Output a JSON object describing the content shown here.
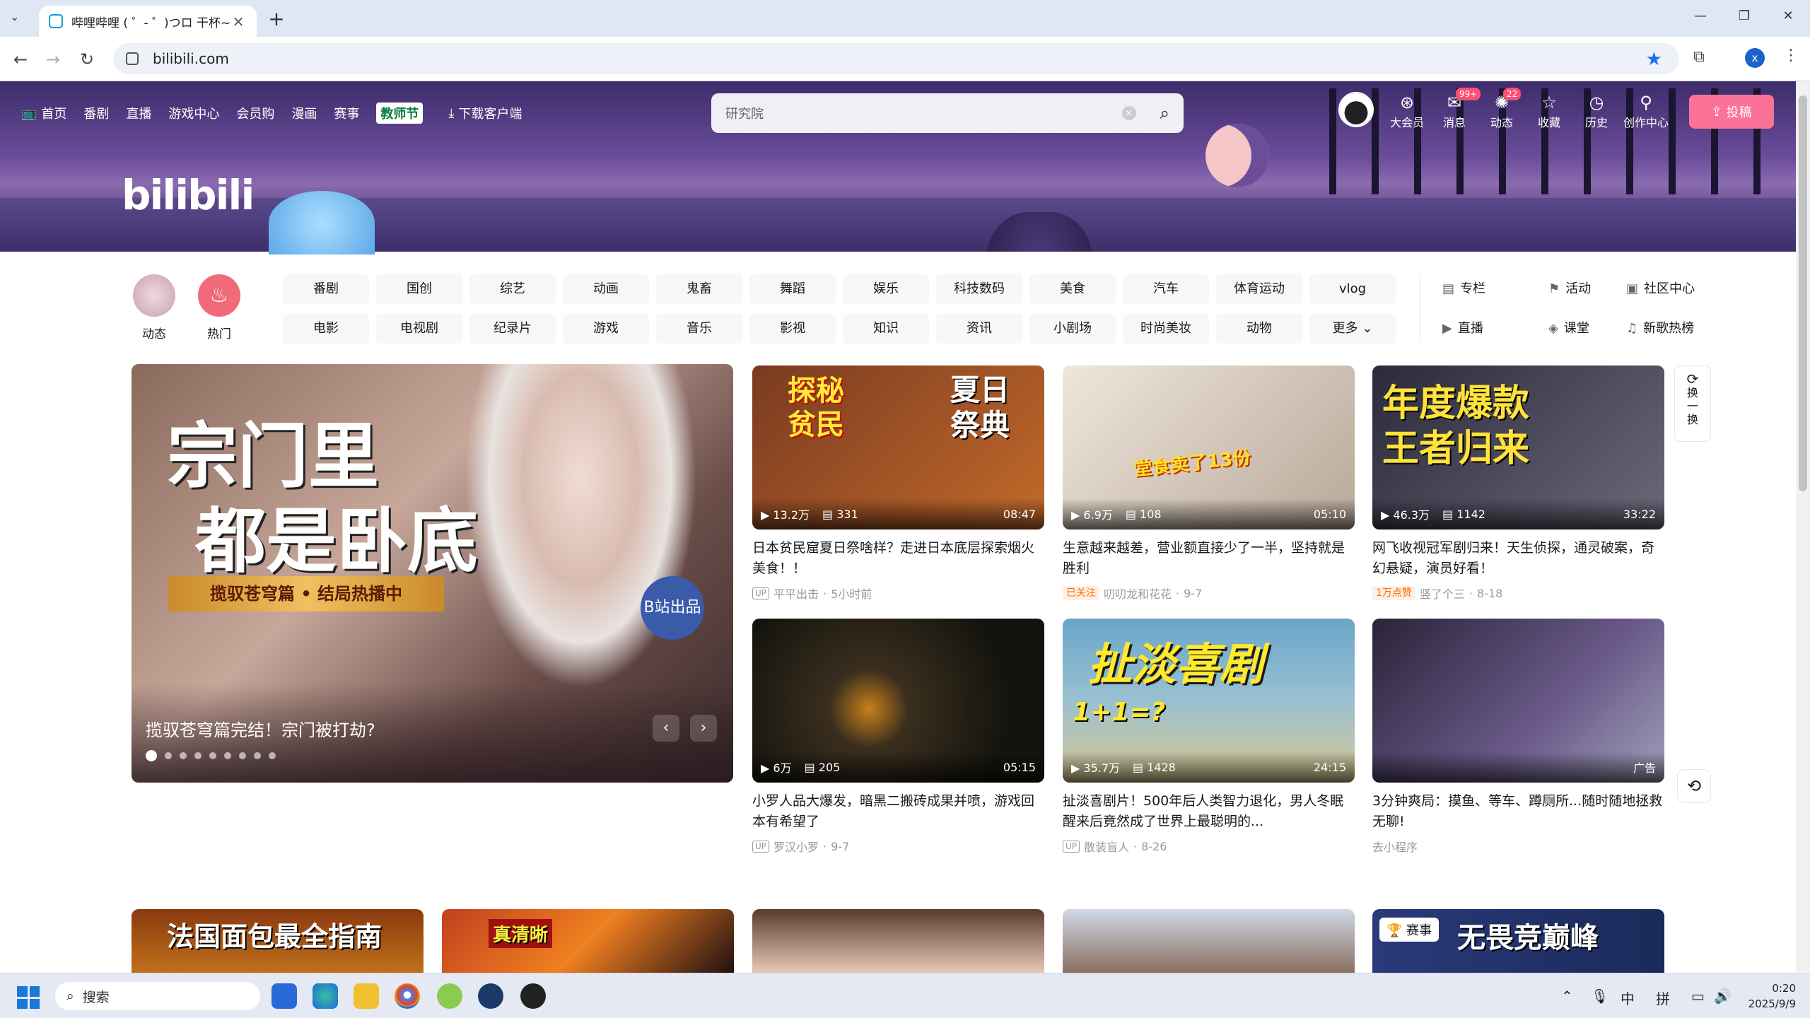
{
  "browser": {
    "tab_title": "哔哩哔哩 ( ゜- ゜)つロ 干杯~-b",
    "url": "bilibili.com"
  },
  "header": {
    "nav": [
      "首页",
      "番剧",
      "直播",
      "游戏中心",
      "会员购",
      "漫画",
      "赛事",
      "教师节",
      "下载客户端"
    ],
    "search_placeholder": "研究院",
    "right_items": [
      {
        "label": "大会员",
        "icon": "vip-icon",
        "badge": ""
      },
      {
        "label": "消息",
        "icon": "message-icon",
        "badge": "99+"
      },
      {
        "label": "动态",
        "icon": "dynamic-icon",
        "badge": "22"
      },
      {
        "label": "收藏",
        "icon": "star-icon",
        "badge": ""
      },
      {
        "label": "历史",
        "icon": "clock-icon",
        "badge": ""
      },
      {
        "label": "创作中心",
        "icon": "bulb-icon",
        "badge": ""
      }
    ],
    "upload_label": "投稿",
    "logo_text": "bilibili"
  },
  "channels": {
    "left": [
      {
        "label": "动态",
        "icon": "dynamic-avatar-icon"
      },
      {
        "label": "热门",
        "icon": "fire-icon"
      }
    ],
    "row1": [
      "番剧",
      "国创",
      "综艺",
      "动画",
      "鬼畜",
      "舞蹈",
      "娱乐",
      "科技数码",
      "美食",
      "汽车",
      "体育运动",
      "vlog"
    ],
    "row2": [
      "电影",
      "电视剧",
      "纪录片",
      "游戏",
      "音乐",
      "影视",
      "知识",
      "资讯",
      "小剧场",
      "时尚美妆",
      "动物",
      "更多"
    ],
    "right_links": [
      {
        "label": "专栏",
        "icon": "column-icon"
      },
      {
        "label": "活动",
        "icon": "flag-icon"
      },
      {
        "label": "社区中心",
        "icon": "community-icon"
      },
      {
        "label": "直播",
        "icon": "live-icon"
      },
      {
        "label": "课堂",
        "icon": "classroom-icon"
      },
      {
        "label": "新歌热榜",
        "icon": "music-chart-icon"
      }
    ]
  },
  "hero": {
    "caption": "揽驭苍穹篇完结！宗门被打劫?",
    "big_text_line1": "宗门里",
    "big_text_line2": "都是卧底",
    "ribbon": "揽驭苍穹篇 • 结局热播中",
    "badge": "B站出品",
    "dots": 9,
    "active_dot": 0
  },
  "videos": [
    {
      "title": "日本贫民窟夏日祭啥样？走进日本底层探索烟火美食！！",
      "views": "13.2万",
      "danmaku": "331",
      "duration": "08:47",
      "author": "平平出击",
      "date": "5小时前",
      "tag": "",
      "thumb_text": "探秘贫民 夏日祭典",
      "colors": [
        "#7a3a20",
        "#c26a2a"
      ]
    },
    {
      "title": "生意越来越差，营业额直接少了一半，坚持就是胜利",
      "views": "6.9万",
      "danmaku": "108",
      "duration": "05:10",
      "author": "叨叨龙和花花",
      "date": "9-7",
      "tag": "已关注",
      "thumb_text": "堂食卖了13份",
      "colors": [
        "#e8e0d8",
        "#b8a898"
      ]
    },
    {
      "title": "网飞收视冠军剧归来！天生侦探，通灵破案，奇幻悬疑，演员好看！",
      "views": "46.3万",
      "danmaku": "1142",
      "duration": "33:22",
      "author": "竖了个三",
      "date": "8-18",
      "tag": "1万点赞",
      "thumb_text": "年度爆款 王者归来",
      "colors": [
        "#2a2a3a",
        "#5a5a6a"
      ]
    },
    {
      "title": "小罗人品大爆发，暗黑二搬砖成果并喷，游戏回本有希望了",
      "views": "6万",
      "danmaku": "205",
      "duration": "05:15",
      "author": "罗汉小罗",
      "date": "9-7",
      "tag": "",
      "thumb_text": "",
      "colors": [
        "#1a1a14",
        "#3a3424"
      ]
    },
    {
      "title": "扯淡喜剧片！500年后人类智力退化，男人冬眠醒来后竟然成了世界上最聪明的...",
      "views": "35.7万",
      "danmaku": "1428",
      "duration": "24:15",
      "author": "散装盲人",
      "date": "8-26",
      "tag": "",
      "thumb_text": "扯淡喜剧 1+1=?",
      "colors": [
        "#6aa6c8",
        "#d8c890"
      ]
    },
    {
      "title": "3分钟爽局：摸鱼、等车、蹲厕所...随时随地拯救无聊!",
      "views": "",
      "danmaku": "",
      "duration": "",
      "author": "去小程序",
      "date": "",
      "tag": "",
      "ad": "广告",
      "thumb_text": "",
      "colors": [
        "#3a3048",
        "#6a5a8a"
      ]
    }
  ],
  "refresh_label": "换一换",
  "row3_texts": [
    "法国面包最全指南",
    "真清晰",
    "",
    "",
    "无畏竞巅峰"
  ],
  "taskbar": {
    "search_label": "搜索",
    "ime1": "中",
    "ime2": "拼",
    "time": "0:20",
    "date": "2025/9/9"
  }
}
